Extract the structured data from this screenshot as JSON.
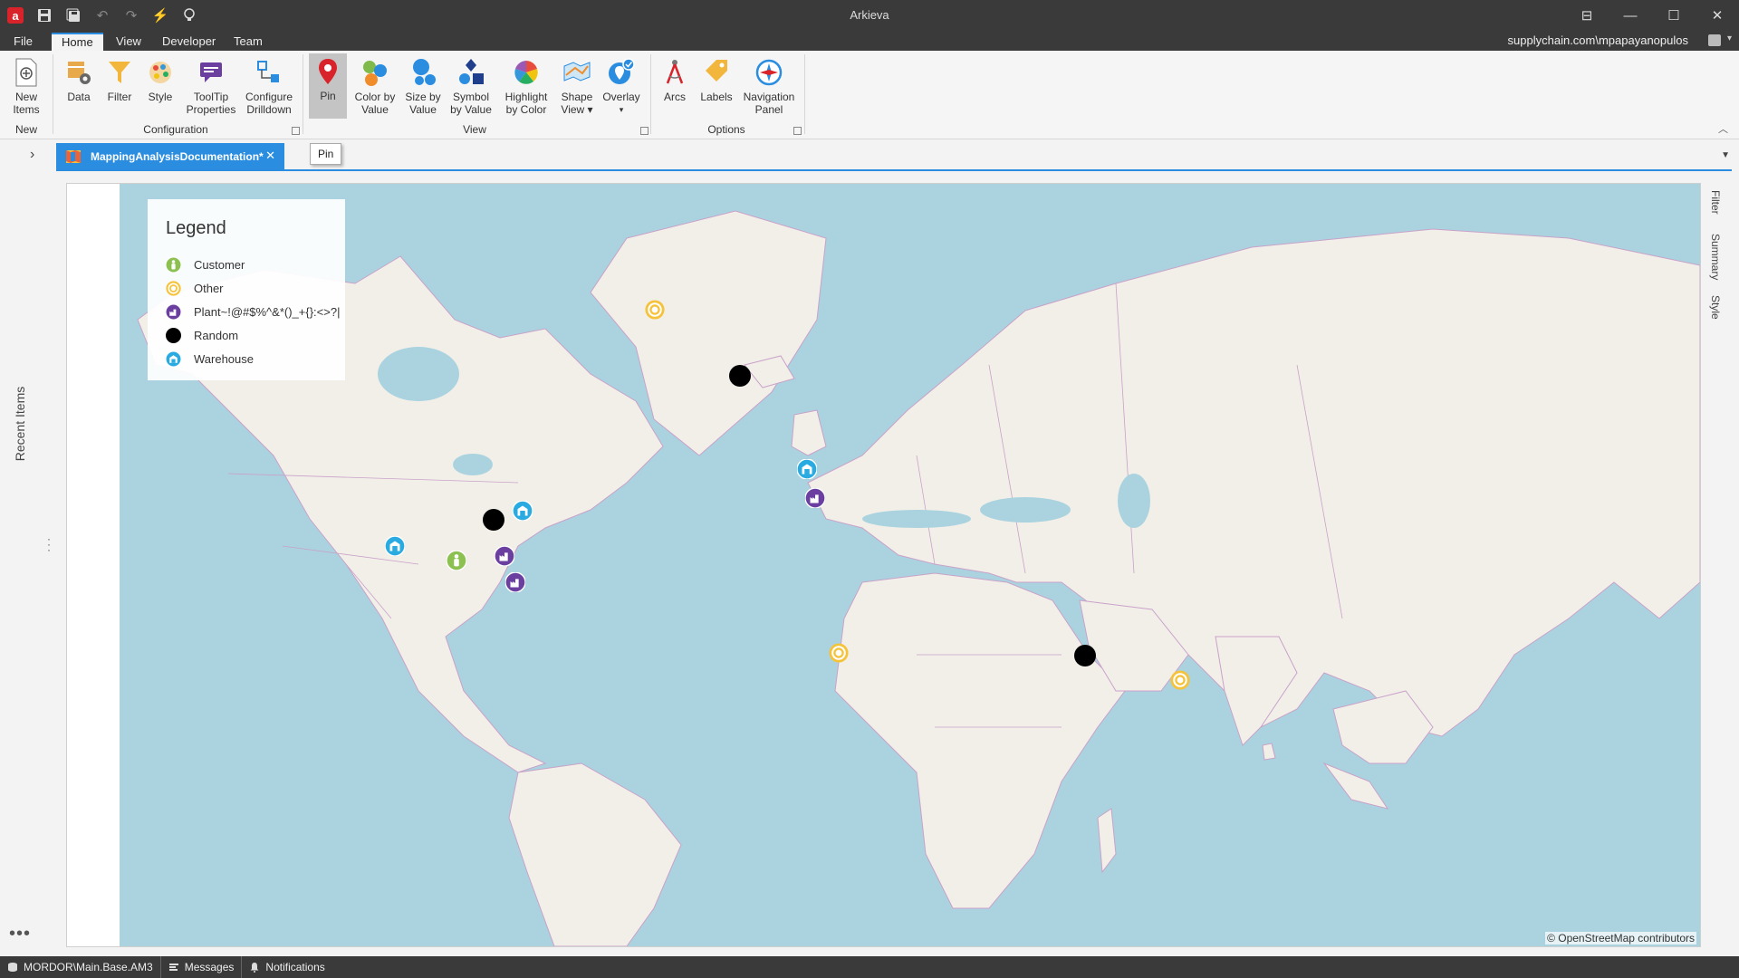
{
  "window": {
    "title": "Arkieva"
  },
  "menu_tabs": [
    "File",
    "Home",
    "View",
    "Developer",
    "Team"
  ],
  "active_tab": "Home",
  "user": "supplychain.com\\mpapayanopulos",
  "ribbon": {
    "new_items": "New Items",
    "data": "Data",
    "filter": "Filter",
    "style": "Style",
    "tooltip_properties": "ToolTip Properties",
    "configure_drilldown": "Configure Drilldown",
    "pin": "Pin",
    "color_by_value": "Color by Value",
    "size_by_value": "Size by Value",
    "symbol_by_value": "Symbol by Value",
    "highlight_by_color": "Highlight by Color",
    "shape_view": "Shape View",
    "overlay": "Overlay",
    "arcs": "Arcs",
    "labels": "Labels",
    "navigation_panel": "Navigation Panel",
    "groups": {
      "new": "New",
      "configuration": "Configuration",
      "view": "View",
      "options": "Options"
    }
  },
  "document_tab": {
    "label": "MappingAnalysisDocumentation*"
  },
  "tooltip": "Pin",
  "side": {
    "recent_items": "Recent Items"
  },
  "right_panel": [
    "Filter",
    "Summary",
    "Style"
  ],
  "legend": {
    "title": "Legend",
    "items": [
      {
        "label": "Customer",
        "type": "customer",
        "color": "#8cc152"
      },
      {
        "label": "Other",
        "type": "other",
        "color": "#f5c33b"
      },
      {
        "label": "Plant~!@#$%^&*()_+{}:<>?|",
        "type": "plant",
        "color": "#6b3fa0"
      },
      {
        "label": "Random",
        "type": "random",
        "color": "#000000"
      },
      {
        "label": "Warehouse",
        "type": "warehouse",
        "color": "#29abe2"
      }
    ]
  },
  "map": {
    "attribution": "© OpenStreetMap contributors"
  },
  "status": {
    "database": "MORDOR\\Main.Base.AM3",
    "messages": "Messages",
    "notifications": "Notifications"
  },
  "colors": {
    "accent": "#2a8de0",
    "water": "#aad3df",
    "land": "#f2efe9",
    "border": "#c9a2c9"
  }
}
